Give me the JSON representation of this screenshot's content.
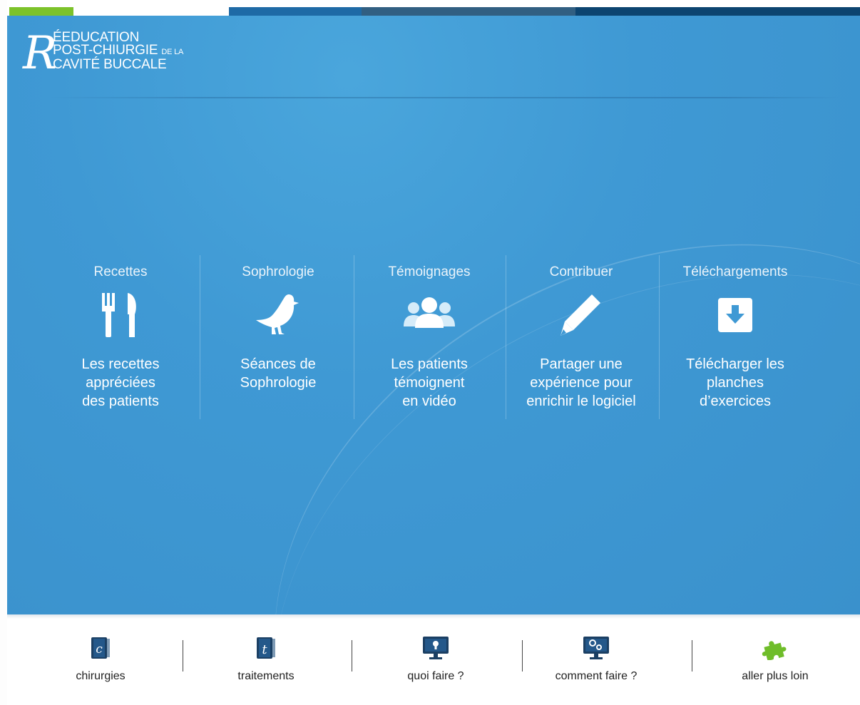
{
  "logo": {
    "initial": "R",
    "line1": "ÉEDUCATION",
    "line2": "POST-CHIURGIE",
    "line2_small": "DE LA",
    "line3": "CAVITÉ BUCCALE"
  },
  "top_bar_colors": [
    "#7cc22a",
    "#1e6aa6",
    "#315f82",
    "#0c4470"
  ],
  "features": [
    {
      "title": "Recettes",
      "icon": "fork-knife-icon",
      "desc": [
        "Les recettes",
        "appréciées",
        "des patients"
      ]
    },
    {
      "title": "Sophrologie",
      "icon": "dove-icon",
      "desc": [
        "Séances de",
        "Sophrologie"
      ]
    },
    {
      "title": "Témoignages",
      "icon": "people-group-icon",
      "desc": [
        "Les patients",
        "témoignent",
        "en vidéo"
      ]
    },
    {
      "title": "Contribuer",
      "icon": "pencil-icon",
      "desc": [
        "Partager une",
        "expérience pour",
        "enrichir le logiciel"
      ]
    },
    {
      "title": "Téléchargements",
      "icon": "download-icon",
      "desc": [
        "Télécharger les",
        "planches",
        "d’exercices"
      ]
    }
  ],
  "bottom_nav": [
    {
      "label": "chirurgies",
      "icon": "book-c-icon",
      "letter": "c"
    },
    {
      "label": "traitements",
      "icon": "book-t-icon",
      "letter": "t"
    },
    {
      "label": "quoi faire ?",
      "icon": "monitor-keyhole-icon"
    },
    {
      "label": "comment faire ?",
      "icon": "monitor-gears-icon"
    },
    {
      "label": "aller plus loin",
      "icon": "puzzle-icon"
    }
  ],
  "colors": {
    "main_blue": "#3f99d4",
    "accent_green": "#7cc22a",
    "dark_navy": "#1b3f63"
  }
}
